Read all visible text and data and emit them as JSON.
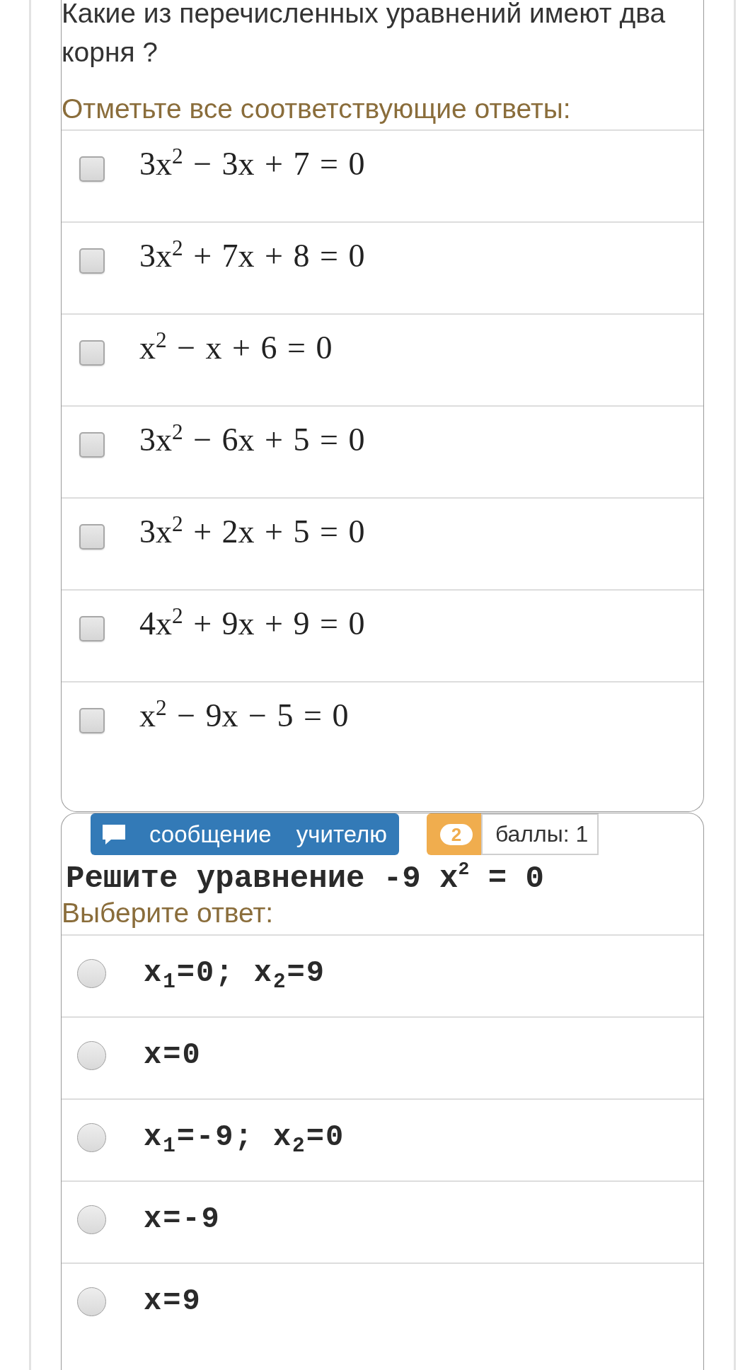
{
  "question_1": {
    "text": "Какие из перечисленных уравнений имеют два корня ?",
    "instruction": "Отметьте все соответствующие ответы:",
    "options": [
      {
        "text": "3x$^{2}$ − 3x + 7 = 0",
        "checked": false
      },
      {
        "text": "3x$^{2}$ + 7x + 8 = 0",
        "checked": false
      },
      {
        "text": "x$^{2}$ − x + 6 = 0",
        "checked": false
      },
      {
        "text": "3x$^{2}$ − 6x + 5 = 0",
        "checked": false
      },
      {
        "text": "3x$^{2}$ + 2x + 5 = 0",
        "checked": false
      },
      {
        "text": "4x$^{2}$ + 9x + 9 = 0",
        "checked": false
      },
      {
        "text": "x$^{2}$ − 9x − 5 = 0",
        "checked": false
      }
    ]
  },
  "question_2": {
    "message_button": "сообщение учителю",
    "number": "2",
    "points": "баллы: 1",
    "text": "Решите уравнение -9 x$^{2}$ = 0",
    "instruction": "Выберите ответ:",
    "options": [
      {
        "text": "x$_{1}$=0; x$_{2}$=9",
        "selected": false
      },
      {
        "text": "x=0",
        "selected": false
      },
      {
        "text": "x$_{1}$=-9; x$_{2}$=0",
        "selected": false
      },
      {
        "text": "x=-9",
        "selected": false
      },
      {
        "text": "x=9",
        "selected": false
      }
    ]
  }
}
